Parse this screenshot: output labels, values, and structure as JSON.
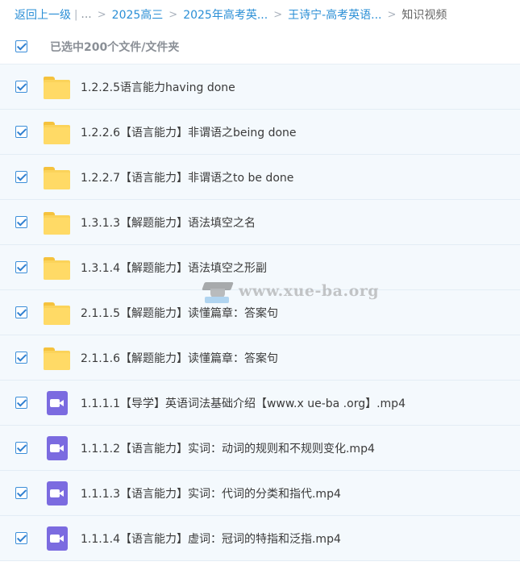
{
  "breadcrumb": {
    "back": "返回上一级",
    "divider": "|",
    "ellipsis": "...",
    "items": [
      "2025高三",
      "2025年高考英...",
      "王诗宁-高考英语..."
    ],
    "current": "知识视频"
  },
  "selection": {
    "label": "已选中200个文件/文件夹",
    "checked": true
  },
  "files": [
    {
      "type": "folder",
      "name": "1.2.2.5语言能力having done",
      "checked": true
    },
    {
      "type": "folder",
      "name": "1.2.2.6【语言能力】非谓语之being done",
      "checked": true
    },
    {
      "type": "folder",
      "name": "1.2.2.7【语言能力】非谓语之to be done",
      "checked": true
    },
    {
      "type": "folder",
      "name": "1.3.1.3【解题能力】语法填空之名",
      "checked": true
    },
    {
      "type": "folder",
      "name": "1.3.1.4【解题能力】语法填空之形副",
      "checked": true
    },
    {
      "type": "folder",
      "name": "2.1.1.5【解题能力】读懂篇章：答案句",
      "checked": true
    },
    {
      "type": "folder",
      "name": "2.1.1.6【解题能力】读懂篇章：答案句",
      "checked": true
    },
    {
      "type": "video",
      "name": "1.1.1.1【导学】英语词法基础介绍【www.x ue-ba .org】.mp4",
      "checked": true
    },
    {
      "type": "video",
      "name": "1.1.1.2【语言能力】实词：动词的规则和不规则变化.mp4",
      "checked": true
    },
    {
      "type": "video",
      "name": "1.1.1.3【语言能力】实词：代词的分类和指代.mp4",
      "checked": true
    },
    {
      "type": "video",
      "name": "1.1.1.4【语言能力】虚词：冠词的特指和泛指.mp4",
      "checked": true
    }
  ],
  "icons": {
    "folder": "folder-icon",
    "video": "video-file-icon",
    "checkbox": "checkbox-checked-icon"
  },
  "watermark": {
    "text": "www.xue-ba.org"
  },
  "colors": {
    "link": "#2b8fd6",
    "row_bg": "#f4f9fd",
    "checkbox": "#2f7fd0",
    "folder": "#fbd35a",
    "video": "#7b6be0"
  }
}
